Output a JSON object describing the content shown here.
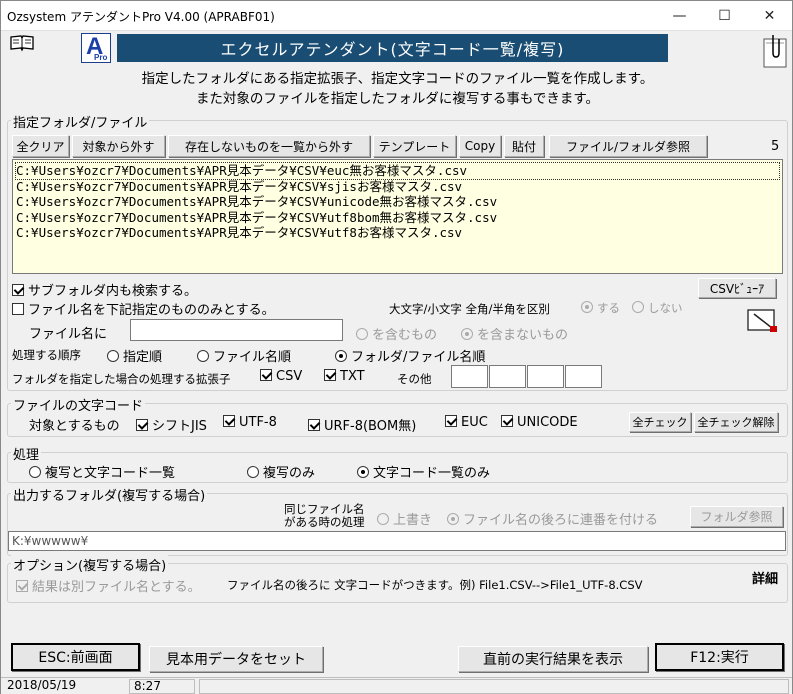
{
  "window": {
    "title": "Ozsystem アテンダントPro V4.00 (APRABF01)",
    "minimize": "—",
    "maximize": "☐",
    "close": "✕"
  },
  "banner": {
    "title": "エクセルアテンダント(文字コード一覧/複写)",
    "logo_letter": "A",
    "logo_sub": "Pro"
  },
  "description": [
    "指定したフォルダにある指定拡張子、指定文字コードのファイル一覧を作成します。",
    "また対象のファイルを指定したフォルダに複写する事もできます。"
  ],
  "files_group": {
    "label": "指定フォルダ/ファイル",
    "buttons": {
      "clear_all": "全クリア",
      "remove_target": "対象から外す",
      "remove_missing": "存在しないものを一覧から外す",
      "template": "テンプレート",
      "copy": "Copy",
      "paste": "貼付",
      "browse": "ファイル/フォルダ参照"
    },
    "count": "5",
    "files": [
      "C:¥Users¥ozcr7¥Documents¥APR見本データ¥CSV¥euc無お客様マスタ.csv",
      "C:¥Users¥ozcr7¥Documents¥APR見本データ¥CSV¥sjisお客様マスタ.csv",
      "C:¥Users¥ozcr7¥Documents¥APR見本データ¥CSV¥unicode無お客様マスタ.csv",
      "C:¥Users¥ozcr7¥Documents¥APR見本データ¥CSV¥utf8bom無お客様マスタ.csv",
      "C:¥Users¥ozcr7¥Documents¥APR見本データ¥CSV¥utf8お客様マスタ.csv"
    ],
    "search_subfolders": "サブフォルダ内も検索する。",
    "csv_viewer": "CSVﾋﾞｭｰｱ",
    "filename_only": "ファイル名を下記指定のもののみとする。",
    "case_label": "大文字/小文字 全角/半角を区別",
    "case_yes": "する",
    "case_no": "しない",
    "filename_label": "ファイル名に",
    "filename_value": "",
    "contains": "を含むもの",
    "not_contains": "を含まないもの",
    "order_label": "処理する順序",
    "order_specified": "指定順",
    "order_filename": "ファイル名順",
    "order_folder_file": "フォルダ/ファイル名順",
    "ext_label": "フォルダを指定した場合の処理する拡張子",
    "ext_csv": "CSV",
    "ext_txt": "TXT",
    "ext_other": "その他",
    "ext_other_values": [
      "",
      "",
      "",
      ""
    ]
  },
  "encoding_group": {
    "label": "ファイルの文字コード",
    "target_label": "対象とするもの",
    "sjis": "シフトJIS",
    "utf8": "UTF-8",
    "utf8_nobom": "URF-8(BOM無)",
    "euc": "EUC",
    "unicode": "UNICODE",
    "check_all": "全チェック",
    "uncheck_all": "全チェック解除"
  },
  "process_group": {
    "label": "処理",
    "copy_and_list": "複写と文字コード一覧",
    "copy_only": "複写のみ",
    "list_only": "文字コード一覧のみ"
  },
  "output_group": {
    "label": "出力するフォルダ(複写する場合)",
    "same_name_label_1": "同じファイル名",
    "same_name_label_2": "がある時の処理",
    "overwrite": "上書き",
    "append_seq": "ファイル名の後ろに連番を付ける",
    "browse": "フォルダ参照",
    "path": "K:¥wwwww¥"
  },
  "option_group": {
    "label": "オプション(複写する場合)",
    "separate_file": "結果は別ファイル名とする。",
    "note": "ファイル名の後ろに 文字コードがつきます。例) File1.CSV-->File1_UTF-8.CSV",
    "detail": "詳細"
  },
  "footer": {
    "esc": "ESC:前画面",
    "sample": "見本用データをセット",
    "show_result": "直前の実行結果を表示",
    "run": "F12:実行"
  },
  "status": {
    "date": "2018/05/19",
    "time": "8:27"
  }
}
